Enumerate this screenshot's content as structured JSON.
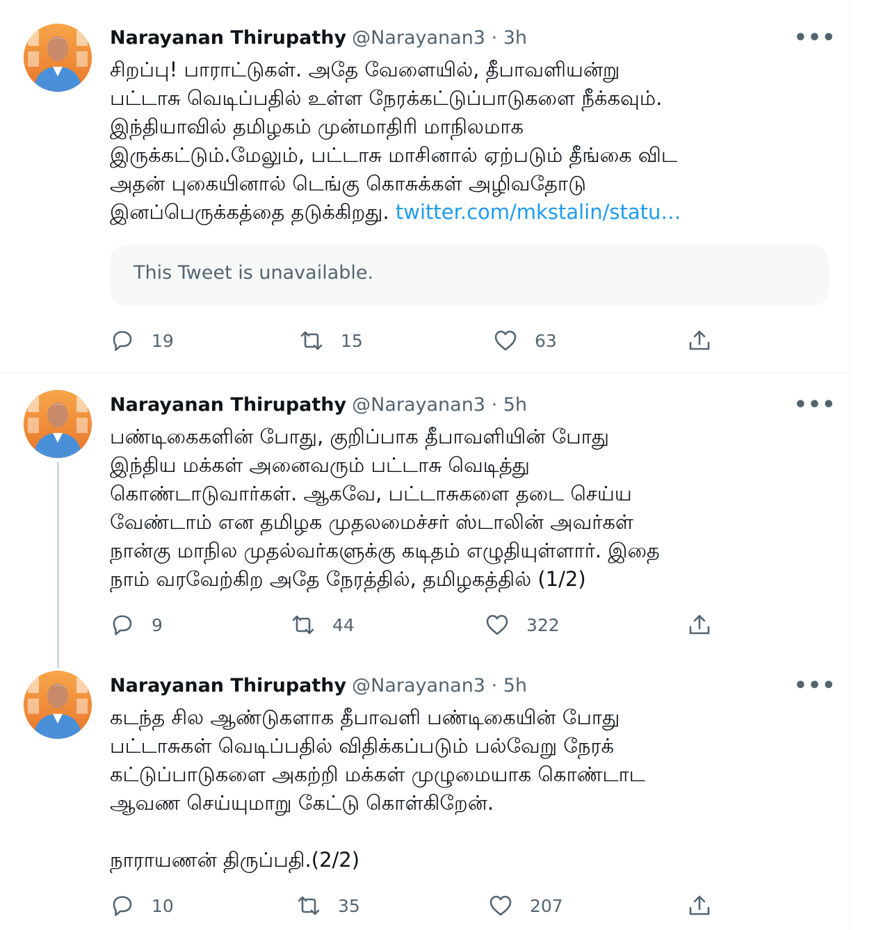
{
  "tweets": [
    {
      "name": "Narayanan Thirupathy",
      "handle": "@Narayanan3 · 3h",
      "lines": [
        "சிறப்பு! பாராட்டுகள். அதே வேளையில், தீபாவளியன்று",
        "பட்டாசு வெடிப்பதில் உள்ள நேரக்கட்டுப்பாடுகளை நீக்கவும்.",
        "இந்தியாவில் தமிழகம் முன்மாதிரி மாநிலமாக",
        "இருக்கட்டும்.மேலும், பட்டாசு மாசினால் ஏற்படும் தீங்கை விட",
        "அதன் புகையினால் டெங்கு கொசுக்கள் அழிவதோடு",
        "இனப்பெருக்கத்தை தடுக்கிறது."
      ],
      "link": "twitter.com/mkstalin/statu…",
      "quote": "This Tweet is unavailable.",
      "replies": "19",
      "retweets": "15",
      "likes": "63"
    },
    {
      "name": "Narayanan Thirupathy",
      "handle": "@Narayanan3 · 5h",
      "lines": [
        "பண்டிகைகளின் போது, குறிப்பாக தீபாவளியின் போது",
        "இந்திய மக்கள் அனைவரும் பட்டாசு வெடித்து",
        "கொண்டாடுவார்கள். ஆகவே, பட்டாசுகளை தடை செய்ய",
        "வேண்டாம் என தமிழக முதலமைச்சர் ஸ்டாலின் அவர்கள்",
        "நான்கு மாநில முதல்வர்களுக்கு கடிதம் எழுதியுள்ளார். இதை",
        "நாம் வரவேற்கிற அதே நேரத்தில், தமிழகத்தில் (1/2)"
      ],
      "replies": "9",
      "retweets": "44",
      "likes": "322"
    },
    {
      "name": "Narayanan Thirupathy",
      "handle": "@Narayanan3 · 5h",
      "lines": [
        "கடந்த சில ஆண்டுகளாக தீபாவளி பண்டிகையின் போது",
        "பட்டாசுகள் வெடிப்பதில் விதிக்கப்படும் பல்வேறு நேரக்",
        "கட்டுப்பாடுகளை அகற்றி மக்கள் முழுமையாக கொண்டாட",
        "ஆவண செய்யுமாறு கேட்டு கொள்கிறேன்.",
        "",
        "நாராயணன் திருப்பதி.(2/2)"
      ],
      "replies": "10",
      "retweets": "35",
      "likes": "207"
    }
  ],
  "colors": {
    "link": "#1d9bf0",
    "secondary": "#536471",
    "avatar_background": "#f28c28",
    "avatar_shirt": "#4a90d9"
  },
  "icons": [
    "more-icon",
    "reply-icon",
    "retweet-icon",
    "like-icon",
    "share-icon"
  ]
}
